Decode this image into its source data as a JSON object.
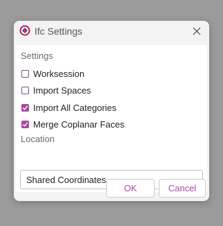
{
  "window": {
    "title": "Ifc Settings"
  },
  "settings_section": {
    "label": "Settings",
    "options": [
      {
        "label": "Worksession",
        "checked": false
      },
      {
        "label": "Import Spaces",
        "checked": false
      },
      {
        "label": "Import All Categories",
        "checked": true
      },
      {
        "label": "Merge Coplanar Faces",
        "checked": true
      }
    ]
  },
  "location_section": {
    "label": "Location",
    "selected": "Shared Coordinates"
  },
  "buttons": {
    "ok": "OK",
    "cancel": "Cancel"
  },
  "colors": {
    "accent": "#a8499e",
    "window_bg": "#f3f3f3",
    "backdrop": "#9b9b9b"
  }
}
